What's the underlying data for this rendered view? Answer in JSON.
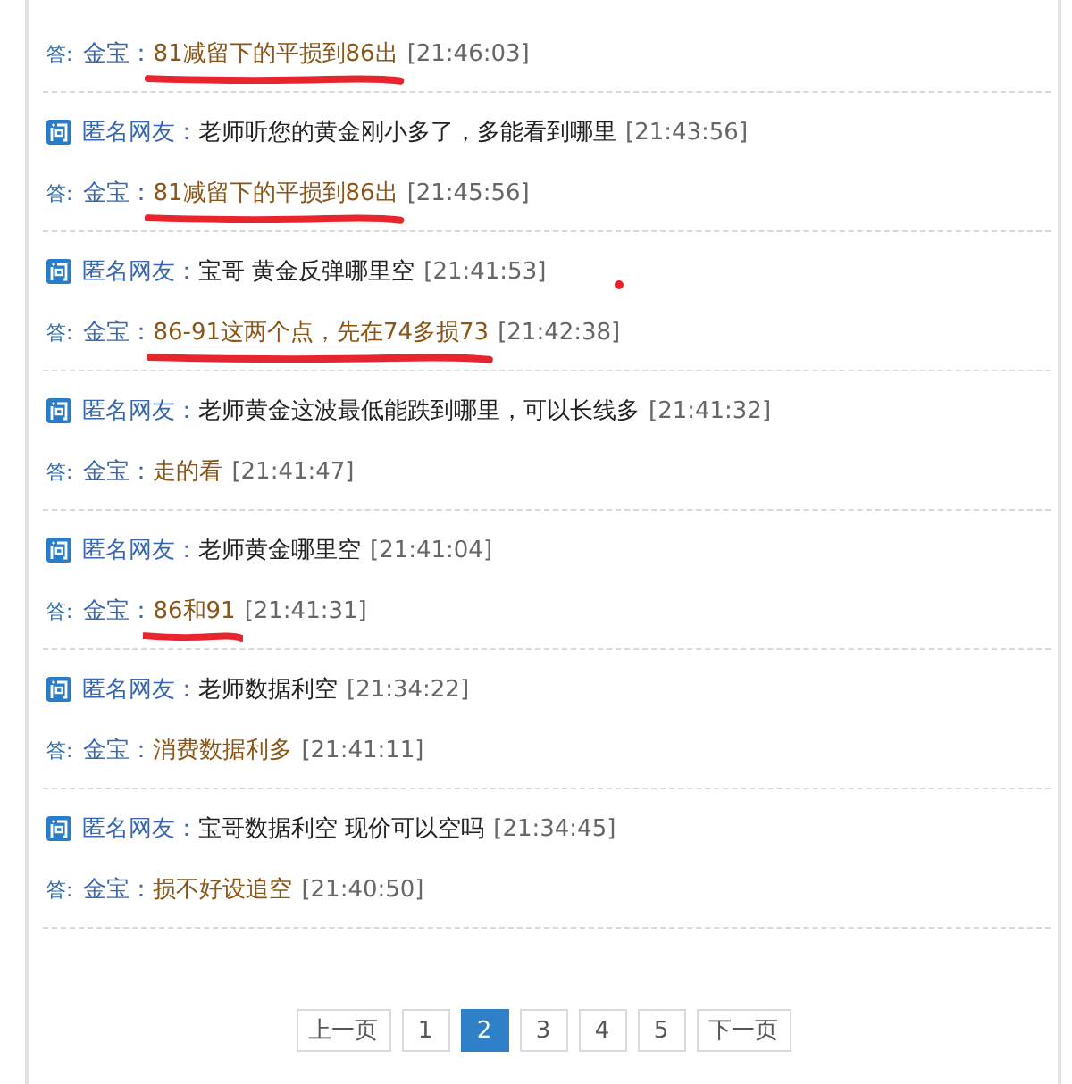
{
  "entries": [
    {
      "answer": {
        "prefix": "答:",
        "user": "金宝",
        "colon": "：",
        "text": "81减留下的平损到86出",
        "time": "[21:46:03]",
        "underlined": true
      }
    },
    {
      "question": {
        "user": "匿名网友：",
        "text": "老师听您的黄金刚小多了，多能看到哪里",
        "time": "[21:43:56]",
        "marked": false
      },
      "answer": {
        "prefix": "答:",
        "user": "金宝",
        "colon": "：",
        "text": "81减留下的平损到86出",
        "time": "[21:45:56]",
        "underlined": true
      }
    },
    {
      "question": {
        "user": "匿名网友：",
        "text": "宝哥 黄金反弹哪里空",
        "time": "[21:41:53]",
        "marked": true
      },
      "answer": {
        "prefix": "答:",
        "user": "金宝",
        "colon": "：",
        "text": "86-91这两个点，先在74多损73",
        "time": "[21:42:38]",
        "underlined": true
      }
    },
    {
      "question": {
        "user": "匿名网友：",
        "text": "老师黄金这波最低能跌到哪里，可以长线多",
        "time": "[21:41:32]",
        "marked": false
      },
      "answer": {
        "prefix": "答:",
        "user": "金宝",
        "colon": "：",
        "text": "走的看",
        "time": "[21:41:47]",
        "underlined": false
      }
    },
    {
      "question": {
        "user": "匿名网友：",
        "text": "老师黄金哪里空",
        "time": "[21:41:04]",
        "marked": false
      },
      "answer": {
        "prefix": "答:",
        "user": "金宝",
        "colon": "：",
        "text": "86和91",
        "time": "[21:41:31]",
        "underlined": true
      }
    },
    {
      "question": {
        "user": "匿名网友：",
        "text": "老师数据利空",
        "time": "[21:34:22]",
        "marked": false
      },
      "answer": {
        "prefix": "答:",
        "user": "金宝",
        "colon": "：",
        "text": "消费数据利多",
        "time": "[21:41:11]",
        "underlined": false
      }
    },
    {
      "question": {
        "user": "匿名网友：",
        "text": "宝哥数据利空 现价可以空吗",
        "time": "[21:34:45]",
        "marked": false
      },
      "answer": {
        "prefix": "答:",
        "user": "金宝",
        "colon": "：",
        "text": "损不好设追空",
        "time": "[21:40:50]",
        "underlined": false
      }
    }
  ],
  "pagination": {
    "prev": "上一页",
    "pages": [
      {
        "label": "1",
        "selected": false
      },
      {
        "label": "2",
        "selected": true
      },
      {
        "label": "3",
        "selected": false
      },
      {
        "label": "4",
        "selected": false
      },
      {
        "label": "5",
        "selected": false
      }
    ],
    "next": "下一页"
  }
}
